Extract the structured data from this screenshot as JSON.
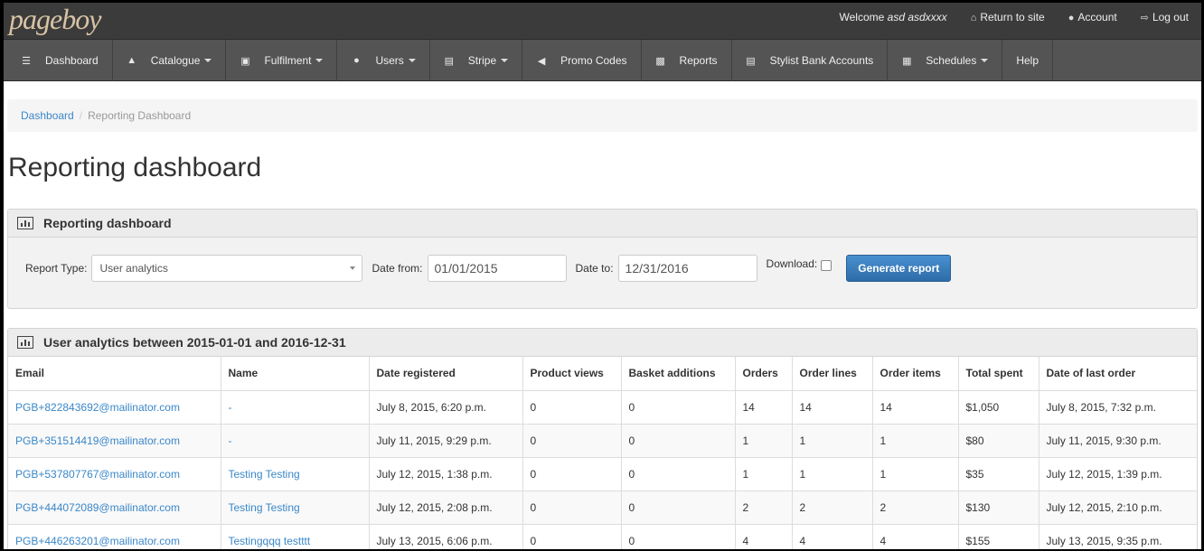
{
  "brand": {
    "logo_text": "pageboy"
  },
  "topnav": {
    "welcome_prefix": "Welcome",
    "user": "asd asdxxxx",
    "return": "Return to site",
    "account": "Account",
    "logout": "Log out"
  },
  "mainnav": [
    {
      "label": "Dashboard",
      "icon": "list-icon",
      "dropdown": false
    },
    {
      "label": "Catalogue",
      "icon": "sitemap-icon",
      "dropdown": true
    },
    {
      "label": "Fulfilment",
      "icon": "cart-icon",
      "dropdown": true
    },
    {
      "label": "Users",
      "icon": "users-icon",
      "dropdown": true
    },
    {
      "label": "Stripe",
      "icon": "credit-card-icon",
      "dropdown": true
    },
    {
      "label": "Promo Codes",
      "icon": "bullhorn-icon",
      "dropdown": false
    },
    {
      "label": "Reports",
      "icon": "bar-chart-icon",
      "dropdown": false
    },
    {
      "label": "Stylist Bank Accounts",
      "icon": "credit-card-icon",
      "dropdown": false
    },
    {
      "label": "Schedules",
      "icon": "calendar-icon",
      "dropdown": true
    },
    {
      "label": "Help",
      "icon": "",
      "dropdown": false
    }
  ],
  "breadcrumb": {
    "home": "Dashboard",
    "sep": "/",
    "current": "Reporting Dashboard"
  },
  "page_title": "Reporting dashboard",
  "form_panel": {
    "title": "Reporting dashboard",
    "report_type_label": "Report Type:",
    "report_type_value": "User analytics",
    "date_from_label": "Date from:",
    "date_from_value": "01/01/2015",
    "date_to_label": "Date to:",
    "date_to_value": "12/31/2016",
    "download_label": "Download:",
    "generate_label": "Generate report"
  },
  "results_panel": {
    "title": "User analytics between 2015-01-01 and 2016-12-31",
    "columns": [
      "Email",
      "Name",
      "Date registered",
      "Product views",
      "Basket additions",
      "Orders",
      "Order lines",
      "Order items",
      "Total spent",
      "Date of last order"
    ],
    "rows": [
      [
        "PGB+822843692@mailinator.com",
        "-",
        "July 8, 2015, 6:20 p.m.",
        "0",
        "0",
        "14",
        "14",
        "14",
        "$1,050",
        "July 8, 2015, 7:32 p.m."
      ],
      [
        "PGB+351514419@mailinator.com",
        "-",
        "July 11, 2015, 9:29 p.m.",
        "0",
        "0",
        "1",
        "1",
        "1",
        "$80",
        "July 11, 2015, 9:30 p.m."
      ],
      [
        "PGB+537807767@mailinator.com",
        "Testing Testing",
        "July 12, 2015, 1:38 p.m.",
        "0",
        "0",
        "1",
        "1",
        "1",
        "$35",
        "July 12, 2015, 1:39 p.m."
      ],
      [
        "PGB+444072089@mailinator.com",
        "Testing Testing",
        "July 12, 2015, 2:08 p.m.",
        "0",
        "0",
        "2",
        "2",
        "2",
        "$130",
        "July 12, 2015, 2:10 p.m."
      ],
      [
        "PGB+446263201@mailinator.com",
        "Testingqqq testttt",
        "July 13, 2015, 6:06 p.m.",
        "0",
        "0",
        "4",
        "4",
        "4",
        "$155",
        "July 13, 2015, 9:35 p.m."
      ]
    ]
  }
}
